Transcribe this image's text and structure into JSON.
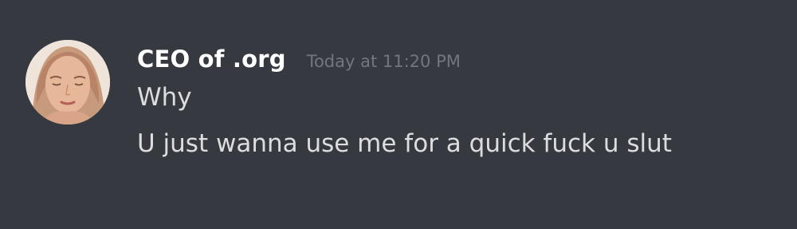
{
  "message": {
    "author": "CEO of  .org",
    "timestamp": "Today at 11:20 PM",
    "lines": [
      "Why",
      "U just wanna use me for a quick fuck u slut"
    ]
  },
  "avatar": {
    "icon": "user-avatar-photo"
  },
  "colors": {
    "background": "#36393f",
    "author": "#ffffff",
    "timestamp": "#72767d",
    "text": "#dcddde"
  }
}
